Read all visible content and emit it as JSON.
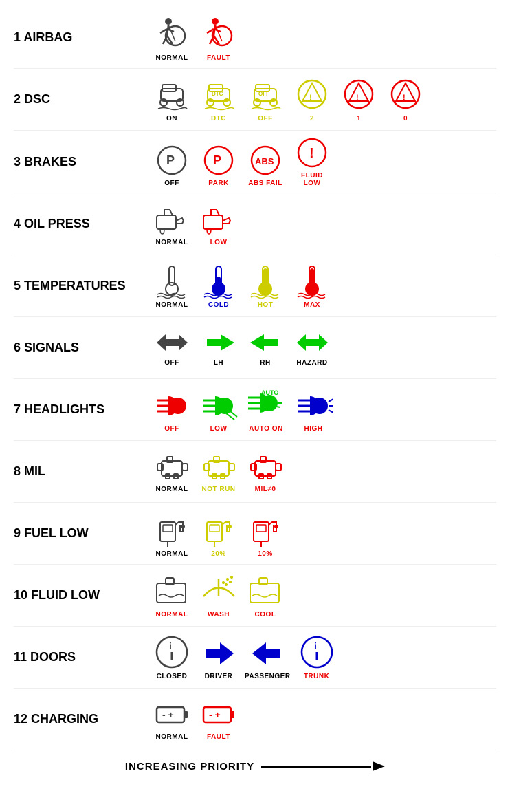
{
  "rows": [
    {
      "id": "airbag",
      "label": "1 AIRBAG",
      "icons": [
        {
          "key": "airbag-normal",
          "sublabel": "NORMAL",
          "labelColor": "black"
        },
        {
          "key": "airbag-fault",
          "sublabel": "FAULT",
          "labelColor": "red"
        }
      ]
    },
    {
      "id": "dsc",
      "label": "2 DSC",
      "icons": [
        {
          "key": "dsc-on",
          "sublabel": "ON",
          "labelColor": "black"
        },
        {
          "key": "dsc-dtc",
          "sublabel": "DTC",
          "labelColor": "yellow"
        },
        {
          "key": "dsc-off",
          "sublabel": "OFF",
          "labelColor": "yellow"
        },
        {
          "key": "dsc-2",
          "sublabel": "2",
          "labelColor": "yellow"
        },
        {
          "key": "dsc-1",
          "sublabel": "1",
          "labelColor": "red"
        },
        {
          "key": "dsc-0",
          "sublabel": "0",
          "labelColor": "red"
        }
      ]
    },
    {
      "id": "brakes",
      "label": "3 BRAKES",
      "icons": [
        {
          "key": "brake-off",
          "sublabel": "OFF",
          "labelColor": "black"
        },
        {
          "key": "brake-park",
          "sublabel": "PARK",
          "labelColor": "red"
        },
        {
          "key": "brake-abs",
          "sublabel": "ABS FAIL",
          "labelColor": "red"
        },
        {
          "key": "brake-fluid",
          "sublabel": "FLUID\nLOW",
          "labelColor": "red"
        }
      ]
    },
    {
      "id": "oilpress",
      "label": "4 OIL PRESS",
      "icons": [
        {
          "key": "oil-normal",
          "sublabel": "NORMAL",
          "labelColor": "black"
        },
        {
          "key": "oil-low",
          "sublabel": "LOW",
          "labelColor": "red"
        }
      ]
    },
    {
      "id": "temps",
      "label": "5 TEMPERATURES",
      "icons": [
        {
          "key": "temp-normal",
          "sublabel": "NORMAL",
          "labelColor": "black"
        },
        {
          "key": "temp-cold",
          "sublabel": "COLD",
          "labelColor": "blue"
        },
        {
          "key": "temp-hot",
          "sublabel": "HOT",
          "labelColor": "yellow"
        },
        {
          "key": "temp-max",
          "sublabel": "MAX",
          "labelColor": "red"
        }
      ]
    },
    {
      "id": "signals",
      "label": "6 SIGNALS",
      "icons": [
        {
          "key": "signal-off",
          "sublabel": "OFF",
          "labelColor": "black"
        },
        {
          "key": "signal-lh",
          "sublabel": "LH",
          "labelColor": "black"
        },
        {
          "key": "signal-rh",
          "sublabel": "RH",
          "labelColor": "black"
        },
        {
          "key": "signal-hazard",
          "sublabel": "HAZARD",
          "labelColor": "black"
        }
      ]
    },
    {
      "id": "headlights",
      "label": "7 HEADLIGHTS",
      "icons": [
        {
          "key": "head-off",
          "sublabel": "OFF",
          "labelColor": "red"
        },
        {
          "key": "head-low",
          "sublabel": "LOW",
          "labelColor": "red"
        },
        {
          "key": "head-auto",
          "sublabel": "AUTO ON",
          "labelColor": "red"
        },
        {
          "key": "head-high",
          "sublabel": "HIGH",
          "labelColor": "red"
        }
      ]
    },
    {
      "id": "mil",
      "label": "8 MIL",
      "icons": [
        {
          "key": "mil-normal",
          "sublabel": "NORMAL",
          "labelColor": "black"
        },
        {
          "key": "mil-notrun",
          "sublabel": "NOT RUN",
          "labelColor": "yellow"
        },
        {
          "key": "mil-mil",
          "sublabel": "MIL≠0",
          "labelColor": "red"
        }
      ]
    },
    {
      "id": "fuellow",
      "label": "9 FUEL LOW",
      "icons": [
        {
          "key": "fuel-normal",
          "sublabel": "NORMAL",
          "labelColor": "black"
        },
        {
          "key": "fuel-20",
          "sublabel": "20%",
          "labelColor": "yellow"
        },
        {
          "key": "fuel-10",
          "sublabel": "10%",
          "labelColor": "red"
        }
      ]
    },
    {
      "id": "fluidlow",
      "label": "10 FLUID LOW",
      "icons": [
        {
          "key": "fluid-normal",
          "sublabel": "NORMAL",
          "labelColor": "red"
        },
        {
          "key": "fluid-wash",
          "sublabel": "WASH",
          "labelColor": "red"
        },
        {
          "key": "fluid-cool",
          "sublabel": "COOL",
          "labelColor": "red"
        }
      ]
    },
    {
      "id": "doors",
      "label": "11 DOORS",
      "icons": [
        {
          "key": "door-closed",
          "sublabel": "CLOSED",
          "labelColor": "black"
        },
        {
          "key": "door-driver",
          "sublabel": "DRIVER",
          "labelColor": "black"
        },
        {
          "key": "door-passenger",
          "sublabel": "PASSENGER",
          "labelColor": "black"
        },
        {
          "key": "door-trunk",
          "sublabel": "TRUNK",
          "labelColor": "red"
        }
      ]
    },
    {
      "id": "charging",
      "label": "12 CHARGING",
      "icons": [
        {
          "key": "charge-normal",
          "sublabel": "NORMAL",
          "labelColor": "black"
        },
        {
          "key": "charge-fault",
          "sublabel": "FAULT",
          "labelColor": "red"
        }
      ]
    }
  ],
  "priority_label": "INCREASING PRIORITY"
}
